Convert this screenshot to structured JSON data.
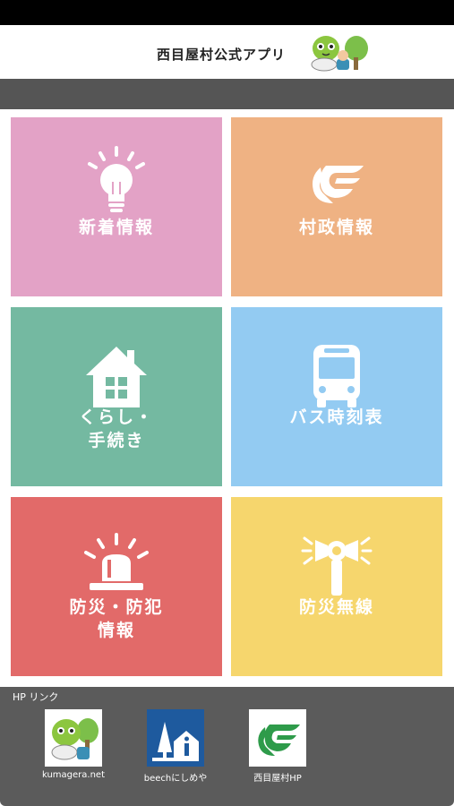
{
  "app": {
    "title": "西目屋村公式アプリ"
  },
  "tiles": [
    {
      "label_line1": "新着情報",
      "label_line2": "",
      "icon": "lightbulb-icon",
      "color": "#e3a2c6"
    },
    {
      "label_line1": "村政情報",
      "label_line2": "",
      "icon": "village-emblem-icon",
      "color": "#efb283"
    },
    {
      "label_line1": "くらし・",
      "label_line2": "手続き",
      "icon": "house-icon",
      "color": "#74b9a1"
    },
    {
      "label_line1": "バス時刻表",
      "label_line2": "",
      "icon": "bus-icon",
      "color": "#93cbf2"
    },
    {
      "label_line1": "防災・防犯",
      "label_line2": "情報",
      "icon": "alarm-light-icon",
      "color": "#e26a69"
    },
    {
      "label_line1": "防災無線",
      "label_line2": "",
      "icon": "loudspeaker-icon",
      "color": "#f6d66d"
    }
  ],
  "hp_links": {
    "heading": "HP リンク",
    "items": [
      {
        "label": "kumagera.net",
        "icon": "mascot-logo-icon"
      },
      {
        "label": "beechにしめや",
        "icon": "beech-logo-icon"
      },
      {
        "label": "西目屋村HP",
        "icon": "village-emblem-logo-icon"
      }
    ]
  }
}
